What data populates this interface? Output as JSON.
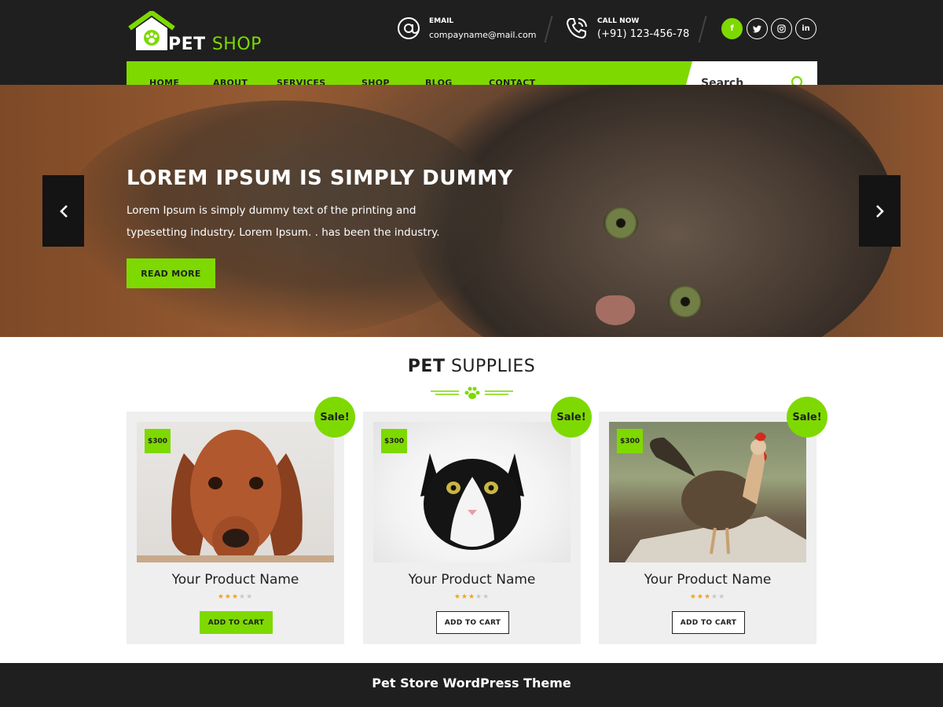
{
  "brand": {
    "name_main": "PET",
    "name_accent": "SHOP"
  },
  "contact": {
    "email_label": "EMAIL",
    "email_value": "compayname@mail.com",
    "call_label": "CALL NOW",
    "call_value": "(+91) 123-456-78"
  },
  "social": [
    {
      "name": "facebook-icon",
      "glyph": "f"
    },
    {
      "name": "twitter-icon",
      "glyph": "t"
    },
    {
      "name": "instagram-icon",
      "glyph": "◎"
    },
    {
      "name": "linkedin-icon",
      "glyph": "in"
    }
  ],
  "nav": {
    "items": [
      "HOME",
      "ABOUT",
      "SERVICES",
      "SHOP",
      "BLOG",
      "CONTACT"
    ]
  },
  "search": {
    "placeholder": "Search"
  },
  "hero": {
    "title": "LOREM IPSUM IS SIMPLY DUMMY",
    "text": "Lorem Ipsum is simply dummy text of the printing and typesetting industry. Lorem Ipsum. . has been the industry.",
    "button": "READ MORE"
  },
  "section": {
    "title_bold": "PET",
    "title_rest": "SUPPLIES"
  },
  "products": [
    {
      "price": "$300",
      "sale": "Sale!",
      "name": "Your Product Name",
      "rating": 3,
      "max_rating": 5,
      "button": "ADD TO CART",
      "image": "dachshund-photo"
    },
    {
      "price": "$300",
      "sale": "Sale!",
      "name": "Your Product Name",
      "rating": 3,
      "max_rating": 5,
      "button": "ADD TO CART",
      "image": "cat-photo"
    },
    {
      "price": "$300",
      "sale": "Sale!",
      "name": "Your Product Name",
      "rating": 3,
      "max_rating": 5,
      "button": "ADD TO CART",
      "image": "rooster-photo"
    }
  ],
  "footer": {
    "text": "Pet Store WordPress Theme"
  },
  "colors": {
    "accent": "#7ed900",
    "dark": "#1f1f1f",
    "card": "#efefef"
  }
}
